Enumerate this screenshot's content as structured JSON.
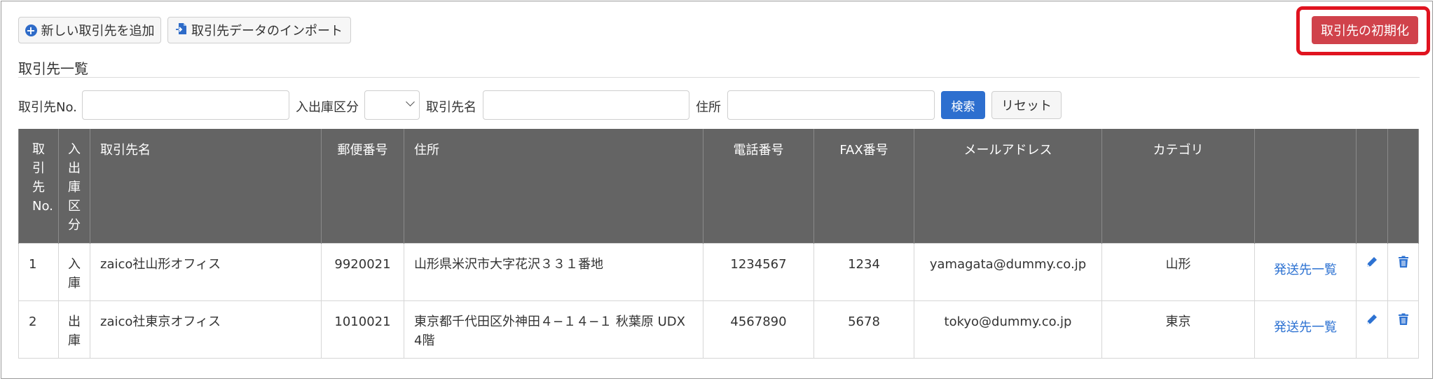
{
  "toolbar": {
    "add_label": "新しい取引先を追加",
    "import_label": "取引先データのインポート",
    "reset_all_label": "取引先の初期化"
  },
  "section": {
    "title": "取引先一覧"
  },
  "search": {
    "no_label": "取引先No.",
    "type_label": "入出庫区分",
    "name_label": "取引先名",
    "address_label": "住所",
    "search_button": "検索",
    "reset_button": "リセット"
  },
  "table": {
    "headers": {
      "no": "取引先No.",
      "type": "入出庫区分",
      "name": "取引先名",
      "zip": "郵便番号",
      "address": "住所",
      "phone": "電話番号",
      "fax": "FAX番号",
      "email": "メールアドレス",
      "category": "カテゴリ"
    },
    "rows": [
      {
        "no": "1",
        "type": "入庫",
        "name": "zaico社山形オフィス",
        "zip": "9920021",
        "address": "山形県米沢市大字花沢３３１番地",
        "phone": "1234567",
        "fax": "1234",
        "email": "yamagata@dummy.co.jp",
        "category": "山形",
        "link": "発送先一覧"
      },
      {
        "no": "2",
        "type": "出庫",
        "name": "zaico社東京オフィス",
        "zip": "1010021",
        "address": "東京都千代田区外神田４−１４−１ 秋葉原 UDX 4階",
        "phone": "4567890",
        "fax": "5678",
        "email": "tokyo@dummy.co.jp",
        "category": "東京",
        "link": "発送先一覧"
      }
    ]
  },
  "colors": {
    "primary": "#2d6fcf",
    "danger": "#d0424b",
    "highlight": "#e0131f",
    "header_bg": "#646464"
  }
}
